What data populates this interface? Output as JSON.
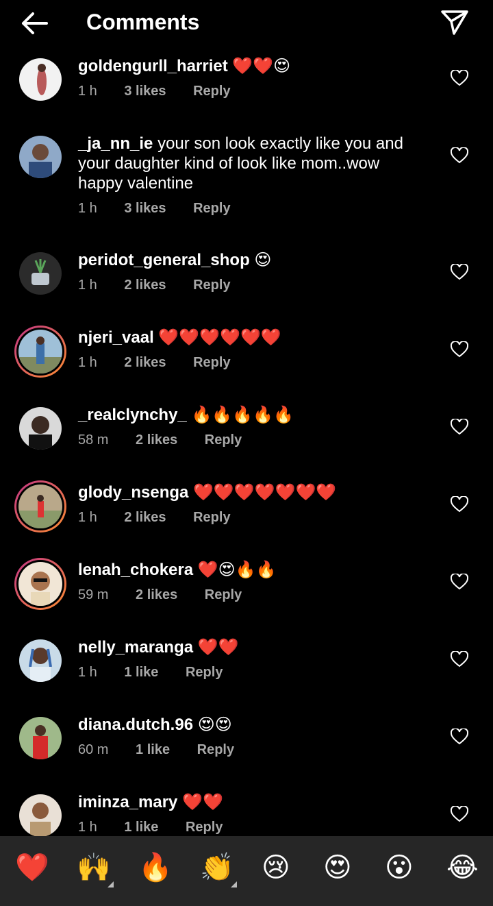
{
  "header": {
    "title": "Comments"
  },
  "comments": [
    {
      "username": "goldengurll_harriet",
      "text": "",
      "emoji": "❤️❤️😍",
      "time": "1 h",
      "likes": "3 likes",
      "reply": "Reply"
    },
    {
      "username": "_ja_nn_ie",
      "text": "your son look exactly like you and your daughter kind of look like mom..wow happy valentine",
      "emoji": "",
      "time": "1 h",
      "likes": "3 likes",
      "reply": "Reply"
    },
    {
      "username": "peridot_general_shop",
      "text": "",
      "emoji": "😍",
      "time": "1 h",
      "likes": "2 likes",
      "reply": "Reply"
    },
    {
      "username": "njeri_vaal",
      "text": "",
      "emoji": "❤️❤️❤️❤️❤️❤️",
      "time": "1 h",
      "likes": "2 likes",
      "reply": "Reply"
    },
    {
      "username": "_realclynchy_",
      "text": "",
      "emoji": "🔥🔥🔥🔥🔥",
      "time": "58 m",
      "likes": "2 likes",
      "reply": "Reply"
    },
    {
      "username": "glody_nsenga",
      "text": "",
      "emoji": "❤️❤️❤️❤️❤️❤️❤️",
      "time": "1 h",
      "likes": "2 likes",
      "reply": "Reply"
    },
    {
      "username": "lenah_chokera",
      "text": "",
      "emoji": "❤️😍🔥🔥",
      "time": "59 m",
      "likes": "2 likes",
      "reply": "Reply"
    },
    {
      "username": "nelly_maranga",
      "text": "",
      "emoji": "❤️❤️",
      "time": "1 h",
      "likes": "1 like",
      "reply": "Reply"
    },
    {
      "username": "diana.dutch.96",
      "text": "",
      "emoji": "😍😍",
      "time": "60 m",
      "likes": "1 like",
      "reply": "Reply"
    },
    {
      "username": "iminza_mary",
      "text": "",
      "emoji": "❤️❤️",
      "time": "1 h",
      "likes": "1 like",
      "reply": "Reply"
    }
  ],
  "emoji_bar": [
    "❤️",
    "🙌",
    "🔥",
    "👏",
    "😢",
    "😍",
    "😮",
    "😂"
  ],
  "icons": {
    "back": "arrow-left-icon",
    "send": "paper-plane-icon",
    "like": "heart-outline-icon"
  },
  "colors": {
    "background": "#000000",
    "meta": "#a8a8a8",
    "emoji_bar": "#262626",
    "story_ring_start": "#c13584",
    "story_ring_end": "#fd8d32"
  }
}
